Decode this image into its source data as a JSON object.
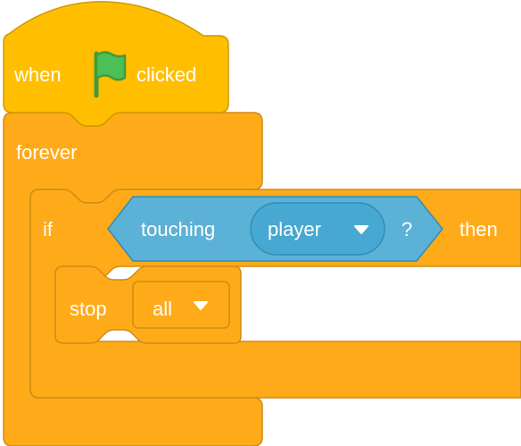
{
  "colors": {
    "events_fill": "#FFBF00",
    "events_stroke": "#CC9900",
    "control_fill": "#FFAB19",
    "control_stroke": "#CF8B17",
    "sensing_fill": "#5CB1D6",
    "sensing_stroke": "#2E8EB8",
    "sensing_dark": "#47A8D1",
    "flag_green": "#4CBF56",
    "flag_stroke": "#45993D",
    "text": "#FFFFFF"
  },
  "hat_block": {
    "when_label": "when",
    "flag_icon": "green-flag-icon",
    "clicked_label": "clicked"
  },
  "forever_block": {
    "label": "forever"
  },
  "if_block": {
    "if_label": "if",
    "then_label": "then",
    "condition": {
      "label": "touching",
      "menu_value": "player",
      "question_mark": "?"
    }
  },
  "stop_block": {
    "label": "stop",
    "menu_value": "all"
  }
}
